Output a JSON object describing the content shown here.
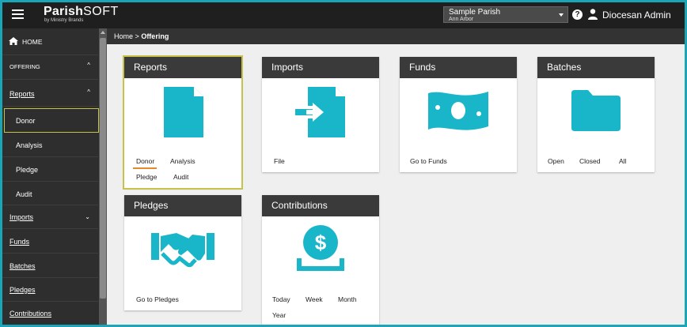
{
  "header": {
    "logo_main": "Parish",
    "logo_soft": "SOFT",
    "logo_sub": "by Ministry Brands",
    "parish_select": {
      "name": "Sample Parish",
      "location": "Ann Arbor"
    },
    "help_label": "?",
    "user_name": "Diocesan Admin"
  },
  "sidebar": {
    "home": "HOME",
    "offering": "OFFERING",
    "reports": "Reports",
    "reports_sub": [
      "Donor",
      "Analysis",
      "Pledge",
      "Audit"
    ],
    "imports": "Imports",
    "funds": "Funds",
    "batches": "Batches",
    "pledges": "Pledges",
    "contributions": "Contributions"
  },
  "breadcrumb": {
    "home": "Home",
    "separator": ">",
    "current": "Offering"
  },
  "cards": {
    "reports": {
      "title": "Reports",
      "links": [
        "Donor",
        "Analysis",
        "Pledge",
        "Audit"
      ]
    },
    "imports": {
      "title": "Imports",
      "links": [
        "File"
      ]
    },
    "funds": {
      "title": "Funds",
      "links": [
        "Go to Funds"
      ]
    },
    "batches": {
      "title": "Batches",
      "links": [
        "Open",
        "Closed",
        "All"
      ]
    },
    "pledges": {
      "title": "Pledges",
      "links": [
        "Go to Pledges"
      ]
    },
    "contributions": {
      "title": "Contributions",
      "links": [
        "Today",
        "Week",
        "Month",
        "Year"
      ]
    }
  },
  "colors": {
    "accent": "#19b5c8",
    "header": "#1f1f1f",
    "sidebar": "#2e2e2e",
    "selected_outline": "#c7c24a",
    "tab_underline": "#e48a2a"
  },
  "icons": {
    "home": "home-icon",
    "help": "help-icon",
    "user": "user-icon",
    "reports": "document-icon",
    "imports": "file-import-icon",
    "funds": "money-icon",
    "batches": "folder-icon",
    "pledges": "handshake-icon",
    "contributions": "coin-donation-icon"
  }
}
